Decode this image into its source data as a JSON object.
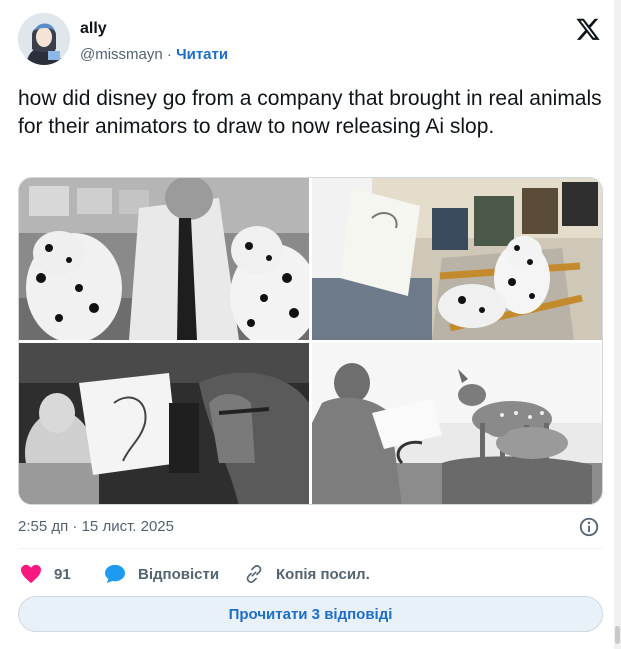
{
  "author": {
    "name": "ally",
    "handle": "@missmayn",
    "separator": "·",
    "follow_label": "Читати"
  },
  "tweet": {
    "text": "how did disney go from a company that brought in real animals for their animators to draw to now releasing Ai slop."
  },
  "media": {
    "photos": [
      {
        "icon": "photo-dalmatians-with-animator"
      },
      {
        "icon": "photo-dalmatian-puppy-on-chair"
      },
      {
        "icon": "photo-horse-with-sketch"
      },
      {
        "icon": "photo-fawns-with-animator"
      }
    ]
  },
  "meta": {
    "time": "2:55 дп",
    "separator": "·",
    "date": "15 лист. 2025"
  },
  "actions": {
    "like_count": "91",
    "reply_label": "Відповісти",
    "copy_label": "Копія посил."
  },
  "read_replies_label": "Прочитати 3 відповіді",
  "colors": {
    "like": "#f91880",
    "reply": "#1d9bf0",
    "link": "#1d6ec5",
    "button_bg": "#e8f1f8"
  }
}
